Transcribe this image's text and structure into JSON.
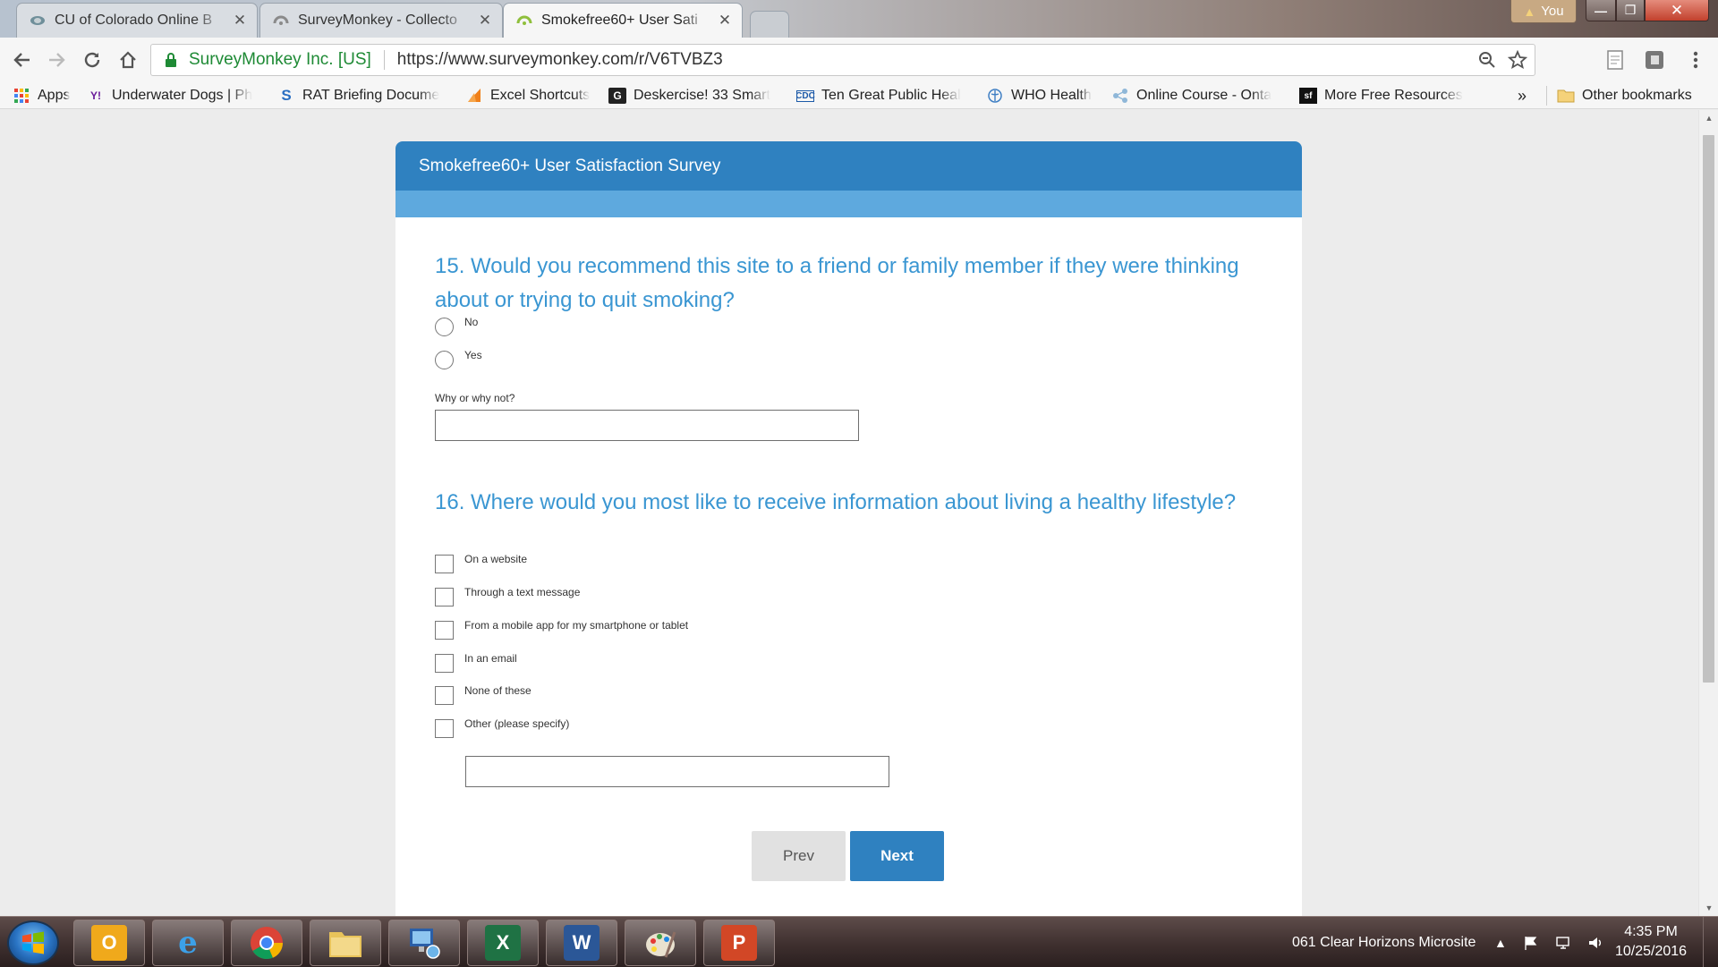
{
  "browser": {
    "tabs": [
      {
        "title": "CU of Colorado Online B",
        "favicon": "cu-logo-icon"
      },
      {
        "title": "SurveyMonkey - Collecto",
        "favicon": "surveymonkey-icon"
      },
      {
        "title": "Smokefree60+ User Sati",
        "favicon": "surveymonkey-icon"
      }
    ],
    "profile": "You",
    "window_controls": {
      "minimize": "—",
      "maximize": "❐",
      "close": "✕"
    },
    "address": {
      "org": "SurveyMonkey Inc. [US]",
      "url": "https://www.surveymonkey.com/r/V6TVBZ3"
    },
    "bookmarks": [
      {
        "label": "Apps",
        "icon": "apps-grid-icon"
      },
      {
        "label": "Underwater Dogs | Ph",
        "icon": "yahoo-icon"
      },
      {
        "label": "RAT Briefing Docume",
        "icon": "s-logo-icon"
      },
      {
        "label": "Excel Shortcuts",
        "icon": "orange-flag-icon"
      },
      {
        "label": "Deskercise! 33 Smart",
        "icon": "g-logo-icon"
      },
      {
        "label": "Ten Great Public Heal",
        "icon": "cdc-icon"
      },
      {
        "label": "WHO Health",
        "icon": "who-icon"
      },
      {
        "label": "Online Course - Onta",
        "icon": "share-icon"
      },
      {
        "label": "More Free Resources",
        "icon": "sf-icon"
      }
    ],
    "bookmarks_overflow": "»",
    "other_bookmarks": "Other bookmarks"
  },
  "survey": {
    "header": "Smokefree60+ User Satisfaction Survey",
    "q15": {
      "title": "15. Would you recommend this site to a friend or family member if they were thinking about or trying to quit smoking?",
      "options": [
        "No",
        "Yes"
      ],
      "comment_label": "Why or why not?",
      "comment_value": ""
    },
    "q16": {
      "title": "16. Where would you most like to receive information about living a healthy lifestyle?",
      "options": [
        "On a website",
        "Through a text message",
        "From a mobile app for my smartphone or tablet",
        "In an email",
        "None of these",
        "Other (please specify)"
      ],
      "other_value": ""
    },
    "prev_label": "Prev",
    "next_label": "Next",
    "colors": {
      "header": "#2f81c0",
      "progress": "#5ea9de",
      "question": "#3a96d2"
    }
  },
  "taskbar": {
    "apps": [
      "outlook-icon",
      "internet-explorer-icon",
      "chrome-icon",
      "file-explorer-icon",
      "remote-desktop-icon",
      "excel-icon",
      "word-icon",
      "paint-icon",
      "powerpoint-icon"
    ],
    "tray_label": "061 Clear Horizons Microsite",
    "time": "4:35 PM",
    "date": "10/25/2016"
  }
}
